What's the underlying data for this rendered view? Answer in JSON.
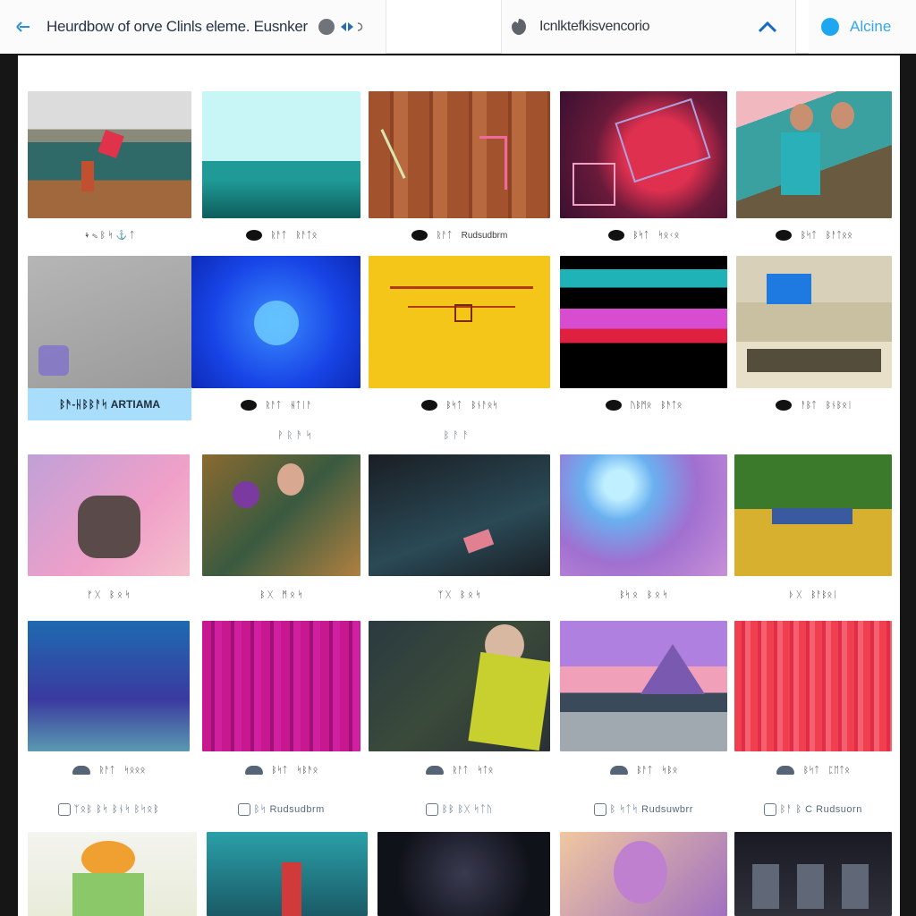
{
  "header": {
    "title": "Heurdbow of orve Clinls eleme. Eusnker",
    "search_text": "Icnlktefkisvencorio",
    "account_name": "Alcine"
  },
  "colors": {
    "accent": "#1ea7f0",
    "panel": "#ffffff",
    "page": "#161616"
  },
  "gallery": {
    "row1": [
      {
        "meta": "⚘ ✎ ᛒ ᛋ ⚓ ᛏ"
      },
      {
        "meta1": "ᚱᚨᛏ",
        "meta2": "ᚱᚨᛏᛟ"
      },
      {
        "meta1": "ᚱᚨᛏ",
        "meta2": "Rudsudbrm"
      },
      {
        "meta1": "ᛒᛋᛏ",
        "meta2": "ᛋᛟᚲᛟ"
      },
      {
        "meta1": "ᛒᛋᛏ",
        "meta2": "ᛒᚨᛏᛟᛟ"
      }
    ],
    "row2": [
      {
        "strip": "ᛒᚫ-ᚺᛒᛒᚨᛋ ARTIAMA"
      },
      {
        "meta1": "ᚱᚨᛏ",
        "meta2": "ᚺᛏᛁᚨ"
      },
      {
        "meta1": "ᛒᛋᛏ",
        "meta2": "ᛒᚾᚨᛟᛋ"
      },
      {
        "meta1": "ᚢᛒᛗᛟ",
        "meta2": "ᛒᚫᛏᛟ"
      },
      {
        "meta1": "ᚨᛒᛏ",
        "meta2": "ᛒᚾᛒᛟᛁ"
      }
    ],
    "row2_captions": [
      "ᚹ ᚱ ᚫ ᛋ",
      "ᛒ ᚨ ᚨ"
    ],
    "row3": [
      {
        "meta1": "ᚠ ᚷ",
        "meta2": "ᛒ ᛟ ᛋ"
      },
      {
        "meta1": "ᛒ ᚷ",
        "meta2": "ᛗ ᛟ ᛋ"
      },
      {
        "meta1": "ᛉ ᚷ",
        "meta2": "ᛒ ᛟ ᛋ"
      },
      {
        "meta1": "ᛒᛋ ᛟ",
        "meta2": "ᛒ ᛟ ᛋ"
      },
      {
        "meta1": "ᚦ ᚷ",
        "meta2": "ᛒᚨᛒᛟᛁ"
      }
    ],
    "row4": [
      {
        "meta1": "ᚱᚨᛏ",
        "meta2": "ᛋᛟᛟᛟ"
      },
      {
        "meta1": "ᛒᛋᛏ",
        "meta2": "ᛋᛒᚫᛟ"
      },
      {
        "meta1": "ᚱᚨᛏ",
        "meta2": "ᛋᛏᛟ"
      },
      {
        "meta1": "ᛒᚨᛏ",
        "meta2": "ᛋᛒᛟ"
      },
      {
        "meta1": "ᛒᛋᛏ",
        "meta2": "ᛈᛖᛏᛟ"
      }
    ],
    "row4_captions": [
      "ᛉᛟᛒ ᛒᛋ ᛒᚾᛋ ᛒᛋᛟᛒ",
      "ᛒᛋ Rudsudbrm",
      "ᛒᛒ ᛒᚷ ᛋᛏᚢ",
      "ᛒ ᛋᛏᛋ Rudsuwbrr",
      "ᛒᚨ ᛒ C Rudsuorn"
    ]
  }
}
